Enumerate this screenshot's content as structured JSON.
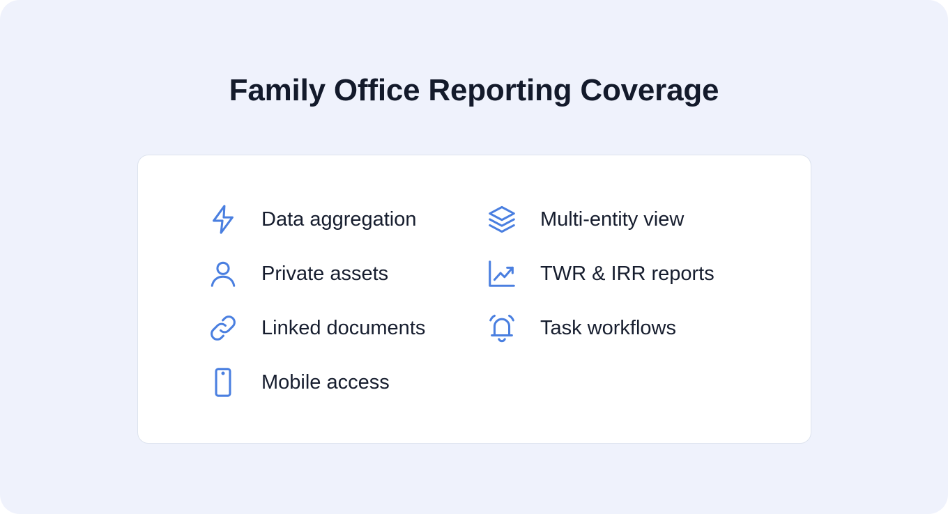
{
  "title": "Family Office Reporting Coverage",
  "accent_color": "#4a7fe0",
  "features": {
    "left": [
      {
        "label": "Data aggregation",
        "icon": "lightning-bolt-icon"
      },
      {
        "label": "Private assets",
        "icon": "user-icon"
      },
      {
        "label": "Linked documents",
        "icon": "link-icon"
      },
      {
        "label": "Mobile access",
        "icon": "smartphone-icon"
      }
    ],
    "right": [
      {
        "label": "Multi-entity view",
        "icon": "layers-icon"
      },
      {
        "label": "TWR & IRR reports",
        "icon": "trending-up-chart-icon"
      },
      {
        "label": "Task workflows",
        "icon": "alarm-bell-icon"
      }
    ]
  }
}
